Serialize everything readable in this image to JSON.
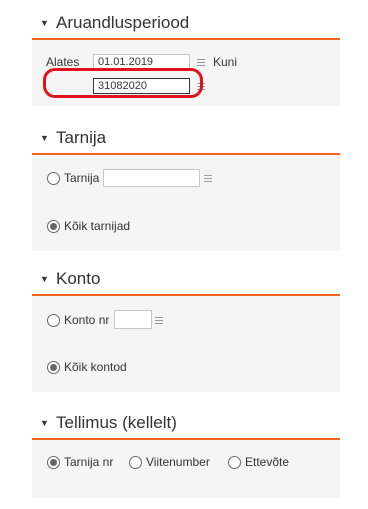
{
  "period": {
    "title": "Aruandlusperiood",
    "from_label": "Alates",
    "from_value": "01.01.2019",
    "to_label": "Kuni",
    "to_value": "31082020"
  },
  "supplier": {
    "title": "Tarnija",
    "option_specific": "Tarnija",
    "option_all": "Kõik tarnijad"
  },
  "account": {
    "title": "Konto",
    "option_specific": "Konto nr",
    "option_all": "Kõik kontod"
  },
  "orders": {
    "title": "Tellimus (kellelt)",
    "options": [
      "Tarnija nr",
      "Viitenumber",
      "Ettevõte"
    ]
  }
}
